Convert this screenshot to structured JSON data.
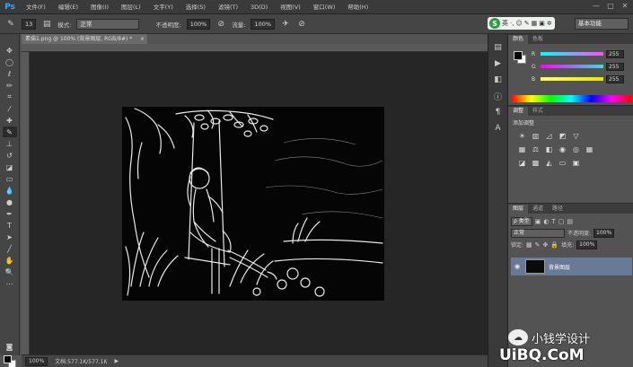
{
  "app": {
    "logo": "Ps"
  },
  "menu": [
    "文件(F)",
    "编辑(E)",
    "图像(I)",
    "图层(L)",
    "文字(Y)",
    "选择(S)",
    "滤镜(T)",
    "3D(D)",
    "视图(V)",
    "窗口(W)",
    "帮助(H)"
  ],
  "window_controls": [
    "—",
    "□",
    "✕"
  ],
  "options": {
    "brush_size": "13",
    "mode_label": "模式:",
    "mode_value": "正常",
    "opacity_label": "不透明度:",
    "opacity_value": "100%",
    "flow_label": "流量:",
    "flow_value": "100%"
  },
  "ime": {
    "logo": "S",
    "labels": [
      "英",
      "·,",
      "☺",
      "✎",
      "▦",
      "▣",
      "✲"
    ]
  },
  "workspace": "基本功能",
  "document": {
    "tab": "素描1.png @ 100% (背景图层, RGB/8#) *",
    "close": "×"
  },
  "status": {
    "zoom": "100%",
    "doc_info": "文档:577.1K/577.1K"
  },
  "color_panel": {
    "tabs": [
      "颜色",
      "色板"
    ],
    "sliders": [
      {
        "label": "R",
        "value": "255",
        "color": "#ff4dff"
      },
      {
        "label": "G",
        "value": "255",
        "color": "#33e0e0"
      },
      {
        "label": "B",
        "value": "255",
        "color": "#e8e800"
      }
    ]
  },
  "adjustments": {
    "tabs": [
      "调整",
      "样式"
    ],
    "title": "添加调整"
  },
  "layers_panel": {
    "tabs": [
      "图层",
      "通道",
      "路径"
    ],
    "kind": "ρ 类型",
    "blend_mode": "正常",
    "opacity_label": "不透明度:",
    "opacity_value": "100%",
    "lock_label": "锁定:",
    "fill_label": "填充:",
    "fill_value": "100%",
    "layer_name": "背景图层"
  },
  "watermark": {
    "line1": "小钱学设计",
    "line2": "UiBQ.CoM"
  }
}
